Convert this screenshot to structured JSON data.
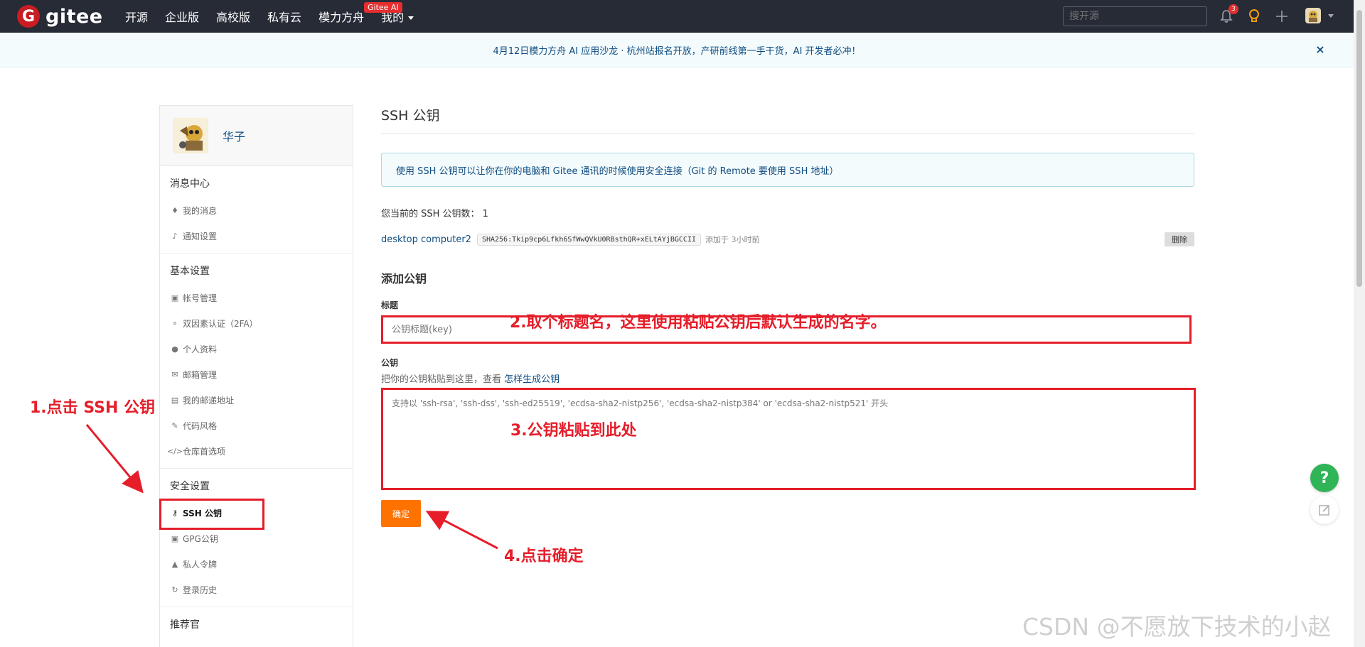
{
  "nav": {
    "logo_letter": "G",
    "logo_text": "gitee",
    "links": [
      "开源",
      "企业版",
      "高校版",
      "私有云",
      "模力方舟",
      "我的"
    ],
    "ai_badge": "Gitee AI",
    "search_placeholder": "搜开源",
    "notification_count": "3",
    "icons": [
      "bell-icon",
      "bulb-icon",
      "plus-icon",
      "avatar"
    ]
  },
  "announcement": {
    "text": "4月12日模力方舟 AI 应用沙龙 · 杭州站报名开放，产研前线第一手干货，AI 开发者必冲！",
    "close": "×"
  },
  "sidebar": {
    "user_name": "华子",
    "groups": [
      {
        "title": "消息中心",
        "items": [
          {
            "label": "我的消息",
            "icon": "bell-icon"
          },
          {
            "label": "通知设置",
            "icon": "speaker-icon"
          }
        ]
      },
      {
        "title": "基本设置",
        "items": [
          {
            "label": "帐号管理",
            "icon": "id-card-icon"
          },
          {
            "label": "双因素认证（2FA）",
            "icon": "user-shield-icon"
          },
          {
            "label": "个人资料",
            "icon": "user-icon"
          },
          {
            "label": "邮箱管理",
            "icon": "mail-icon"
          },
          {
            "label": "我的邮递地址",
            "icon": "address-icon"
          },
          {
            "label": "代码风格",
            "icon": "brush-icon"
          },
          {
            "label": "仓库首选项",
            "icon": "code-icon"
          }
        ]
      },
      {
        "title": "安全设置",
        "items": [
          {
            "label": "SSH 公钥",
            "icon": "key-icon"
          },
          {
            "label": "GPG公钥",
            "icon": "lock-icon"
          },
          {
            "label": "私人令牌",
            "icon": "token-icon"
          },
          {
            "label": "登录历史",
            "icon": "history-icon"
          }
        ]
      },
      {
        "title": "推荐官",
        "items": []
      }
    ]
  },
  "main": {
    "title": "SSH 公钥",
    "info": "使用 SSH 公钥可以让你在你的电脑和 Gitee 通讯的时候使用安全连接（Git 的 Remote 要使用 SSH 地址）",
    "key_count": "您当前的 SSH 公钥数：  1",
    "key": {
      "name": "desktop computer2",
      "fingerprint": "SHA256:Tkip9cp6Lfkh6SfWwQVkU0RBsthQR+xELtAYjBGCCII",
      "added": "添加于 3小时前",
      "delete_label": "删除"
    },
    "add_title": "添加公钥",
    "title_label": "标题",
    "title_placeholder": "公钥标题(key)",
    "pubkey_label": "公钥",
    "help_text": "把你的公钥粘贴到这里，查看 ",
    "help_link": "怎样生成公钥",
    "textarea_placeholder": "支持以 'ssh-rsa', 'ssh-dss', 'ssh-ed25519', 'ecdsa-sha2-nistp256', 'ecdsa-sha2-nistp384' or 'ecdsa-sha2-nistp521' 开头",
    "submit_label": "确定"
  },
  "annotations": {
    "step1": "1.点击 SSH 公钥",
    "step2": "2.取个标题名，这里使用粘贴公钥后默认生成的名字。",
    "step3": "3.公钥粘贴到此处",
    "step4": "4.点击确定",
    "color": "#e51e2a"
  },
  "floating": {
    "help": "?"
  },
  "watermark": "CSDN @不愿放下技术的小赵"
}
